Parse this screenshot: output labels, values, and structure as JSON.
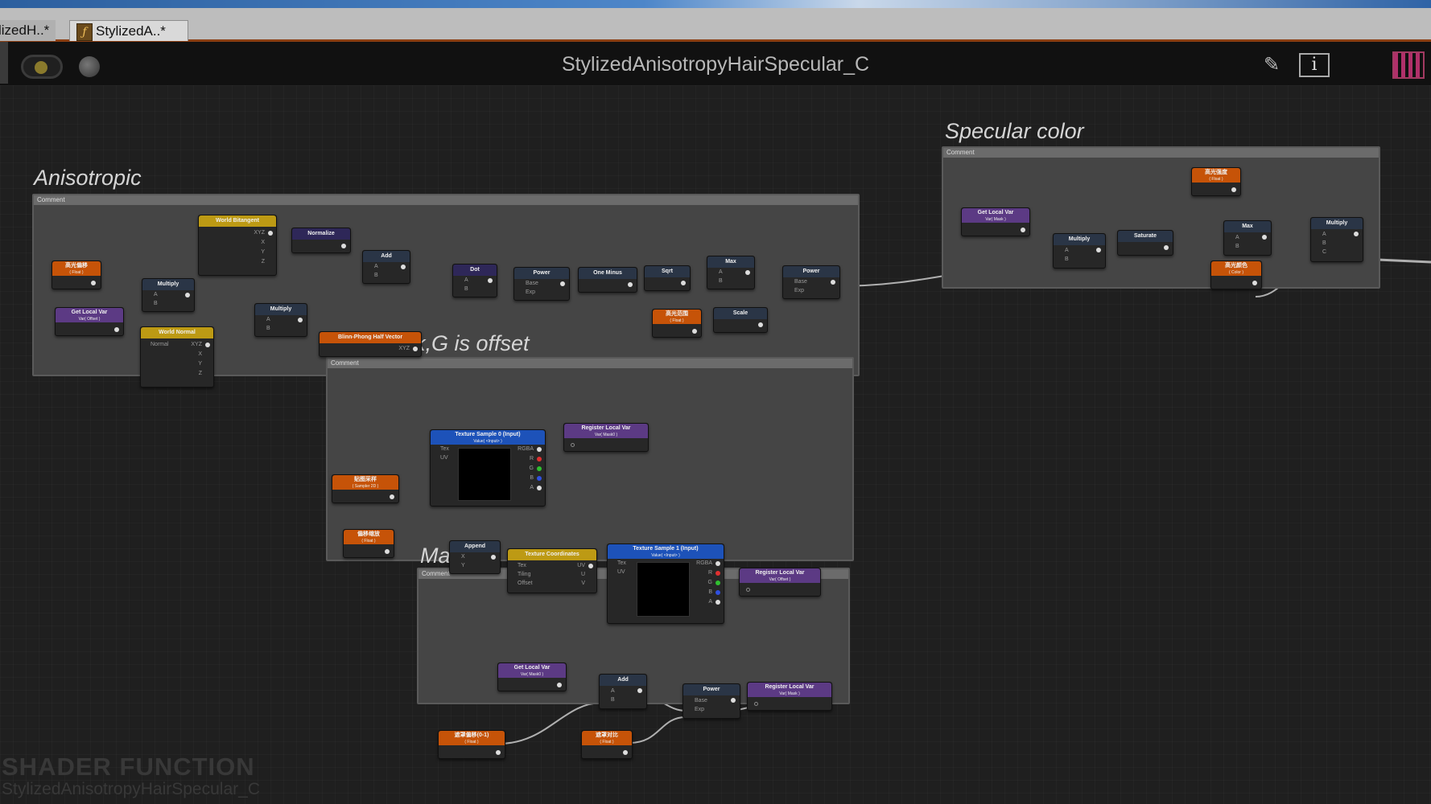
{
  "tabs": [
    {
      "label": "lizedH..*"
    },
    {
      "label": "StylizedA..*",
      "icon": "material-function-icon"
    }
  ],
  "toolbar": {
    "graph_title": "StylizedAnisotropyHairSpecular_C",
    "clean_icon": "broom-icon",
    "info_label": "i",
    "grid_icon": "grid-icon"
  },
  "comments": {
    "anisotropic": {
      "title": "Anisotropic",
      "header": "Comment"
    },
    "specular": {
      "title": "Specular color",
      "header": "Comment"
    },
    "mask_offset": {
      "title": "R is mask,G is offset",
      "header": "Comment"
    },
    "mask": {
      "title": "Mask",
      "header": "Comment"
    }
  },
  "nodes": {
    "an_input1": {
      "title": "高光偏移",
      "sub": "( Float )"
    },
    "an_local_var": {
      "title": "Get Local Var",
      "sub": "Var( Offset )"
    },
    "an_world_bitangent": {
      "title": "World Bitangent",
      "pins": [
        "XYZ",
        "X",
        "Y",
        "Z"
      ]
    },
    "an_normalize": {
      "title": "Normalize"
    },
    "an_multiply1": {
      "title": "Multiply",
      "pins": [
        "A",
        "B"
      ]
    },
    "an_world_normal": {
      "title": "World Normal",
      "pins": [
        "Normal",
        "XYZ",
        "X",
        "Y",
        "Z"
      ]
    },
    "an_multiply2": {
      "title": "Multiply",
      "pins": [
        "A",
        "B"
      ]
    },
    "an_add": {
      "title": "Add",
      "pins": [
        "A",
        "B"
      ]
    },
    "an_blinn": {
      "title": "Blinn-Phong Half Vector",
      "pins": [
        "XYZ"
      ]
    },
    "an_dot": {
      "title": "Dot",
      "pins": [
        "A",
        "B"
      ]
    },
    "an_power1": {
      "title": "Power",
      "pins": [
        "Base",
        "Exp"
      ]
    },
    "an_oneminus": {
      "title": "One Minus"
    },
    "an_sqrt": {
      "title": "Sqrt"
    },
    "an_max": {
      "title": "Max",
      "pins": [
        "A",
        "B"
      ]
    },
    "an_power2": {
      "title": "Power",
      "pins": [
        "Base",
        "Exp"
      ]
    },
    "an_input2": {
      "title": "高光范围",
      "sub": "( Float )"
    },
    "an_scale": {
      "title": "Scale"
    },
    "sp_local_var": {
      "title": "Get Local Var",
      "sub": "Var( Mask )"
    },
    "sp_multiply1": {
      "title": "Multiply",
      "pins": [
        "A",
        "B"
      ]
    },
    "sp_saturate": {
      "title": "Saturate"
    },
    "sp_input1": {
      "title": "高光强度",
      "sub": "( Float )"
    },
    "sp_max": {
      "title": "Max",
      "pins": [
        "A",
        "B"
      ]
    },
    "sp_input2": {
      "title": "高光颜色",
      "sub": "( Color )"
    },
    "sp_multiply2": {
      "title": "Multiply",
      "pins": [
        "A",
        "B",
        "C"
      ]
    },
    "mo_input": {
      "title": "贴图采样",
      "sub": "( Sampler 2D )"
    },
    "mo_tex0": {
      "title": "Texture Sample 0 (Input)",
      "sub": "Value( <Input> )",
      "pins_in": [
        "Tex",
        "UV"
      ],
      "pins_out": [
        "RGBA",
        "R",
        "G",
        "B",
        "A"
      ]
    },
    "mo_reg1": {
      "title": "Register Local Var",
      "sub": "Var( Mask0 )"
    },
    "mo_input2": {
      "title": "偏移缩放",
      "sub": "( Float )"
    },
    "mo_append": {
      "title": "Append",
      "pins": [
        "X",
        "Y"
      ]
    },
    "mo_texcoord": {
      "title": "Texture Coordinates",
      "pins_in": [
        "Tex",
        "Tiling",
        "Offset"
      ],
      "pins_out": [
        "UV",
        "U",
        "V"
      ]
    },
    "mo_tex1": {
      "title": "Texture Sample 1 (Input)",
      "sub": "Value( <Input> )",
      "pins_in": [
        "Tex",
        "UV"
      ],
      "pins_out": [
        "RGBA",
        "R",
        "G",
        "B",
        "A"
      ]
    },
    "mo_reg2": {
      "title": "Register Local Var",
      "sub": "Var( Offset )"
    },
    "mk_local_var": {
      "title": "Get Local Var",
      "sub": "Var( Mask0 )"
    },
    "mk_add": {
      "title": "Add",
      "pins": [
        "A",
        "B"
      ]
    },
    "mk_power": {
      "title": "Power",
      "pins": [
        "Base",
        "Exp"
      ]
    },
    "mk_reg": {
      "title": "Register Local Var",
      "sub": "Var( Mask )"
    },
    "mk_input1": {
      "title": "遮罩偏移(0-1)",
      "sub": "( Float )"
    },
    "mk_input2": {
      "title": "遮罩对比",
      "sub": "( Float )"
    }
  },
  "watermark": {
    "line1": "SHADER FUNCTION",
    "line2": "StylizedAnisotropyHairSpecular_C"
  }
}
